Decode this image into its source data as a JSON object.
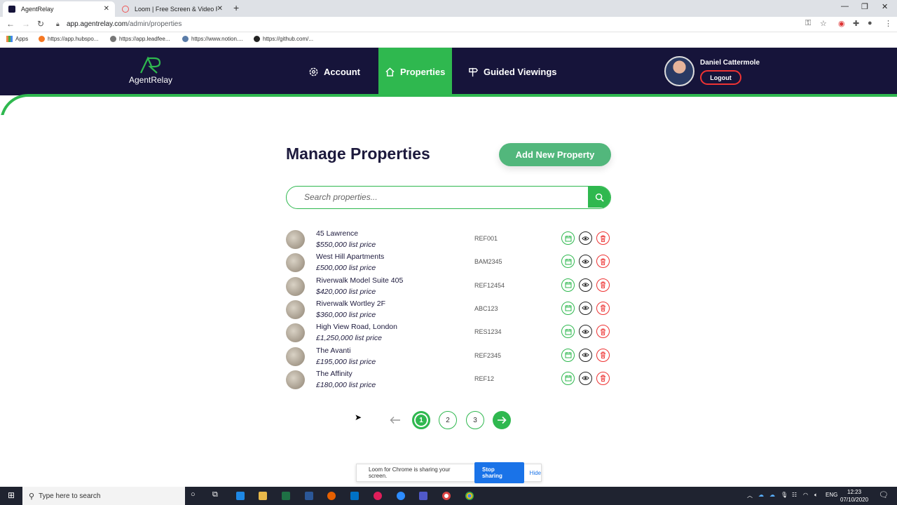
{
  "browser": {
    "tabs": [
      {
        "title": "AgentRelay"
      },
      {
        "title": "Loom | Free Screen & Video Rec..."
      }
    ],
    "url": {
      "host": "app.agentrelay.com",
      "path": "/admin/properties"
    },
    "bookmarks": [
      "Apps",
      "https://app.hubspo...",
      "https://app.leadfee...",
      "https://www.notion....",
      "https://github.com/..."
    ]
  },
  "header": {
    "logo_text": "AgentRelay",
    "nav": [
      {
        "label": "Account",
        "icon": "gear-icon"
      },
      {
        "label": "Properties",
        "icon": "home-icon"
      },
      {
        "label": "Guided Viewings",
        "icon": "signpost-icon"
      }
    ],
    "user_name": "Daniel Cattermole",
    "logout_label": "Logout"
  },
  "main": {
    "title": "Manage Properties",
    "add_button": "Add New Property",
    "search_placeholder": "Search properties...",
    "properties": [
      {
        "name": "45 Lawrence",
        "price": "$550,000 list price",
        "ref": "REF001"
      },
      {
        "name": "West Hill Apartments",
        "price": "£500,000 list price",
        "ref": "BAM2345"
      },
      {
        "name": "Riverwalk Model Suite 405",
        "price": "$420,000 list price",
        "ref": "REF12454"
      },
      {
        "name": "Riverwalk Wortley 2F",
        "price": "$360,000 list price",
        "ref": "ABC123"
      },
      {
        "name": "High View Road, London",
        "price": "£1,250,000 list price",
        "ref": "RES1234"
      },
      {
        "name": "The Avanti",
        "price": "£195,000 list price",
        "ref": "REF2345"
      },
      {
        "name": "The Affinity",
        "price": "£180,000 list price",
        "ref": "REF12"
      }
    ],
    "pagination": {
      "pages": [
        "1",
        "2",
        "3"
      ],
      "current": "1"
    }
  },
  "loom_banner": {
    "text": "Loom for Chrome is sharing your screen.",
    "stop_label": "Stop sharing",
    "hide_label": "Hide"
  },
  "taskbar": {
    "search_placeholder": "Type here to search",
    "language": "ENG",
    "time": "12:23",
    "date": "07/10/2020"
  },
  "colors": {
    "brand_green": "#2fb84f",
    "header_navy": "#16143a",
    "danger_red": "#e33333"
  }
}
